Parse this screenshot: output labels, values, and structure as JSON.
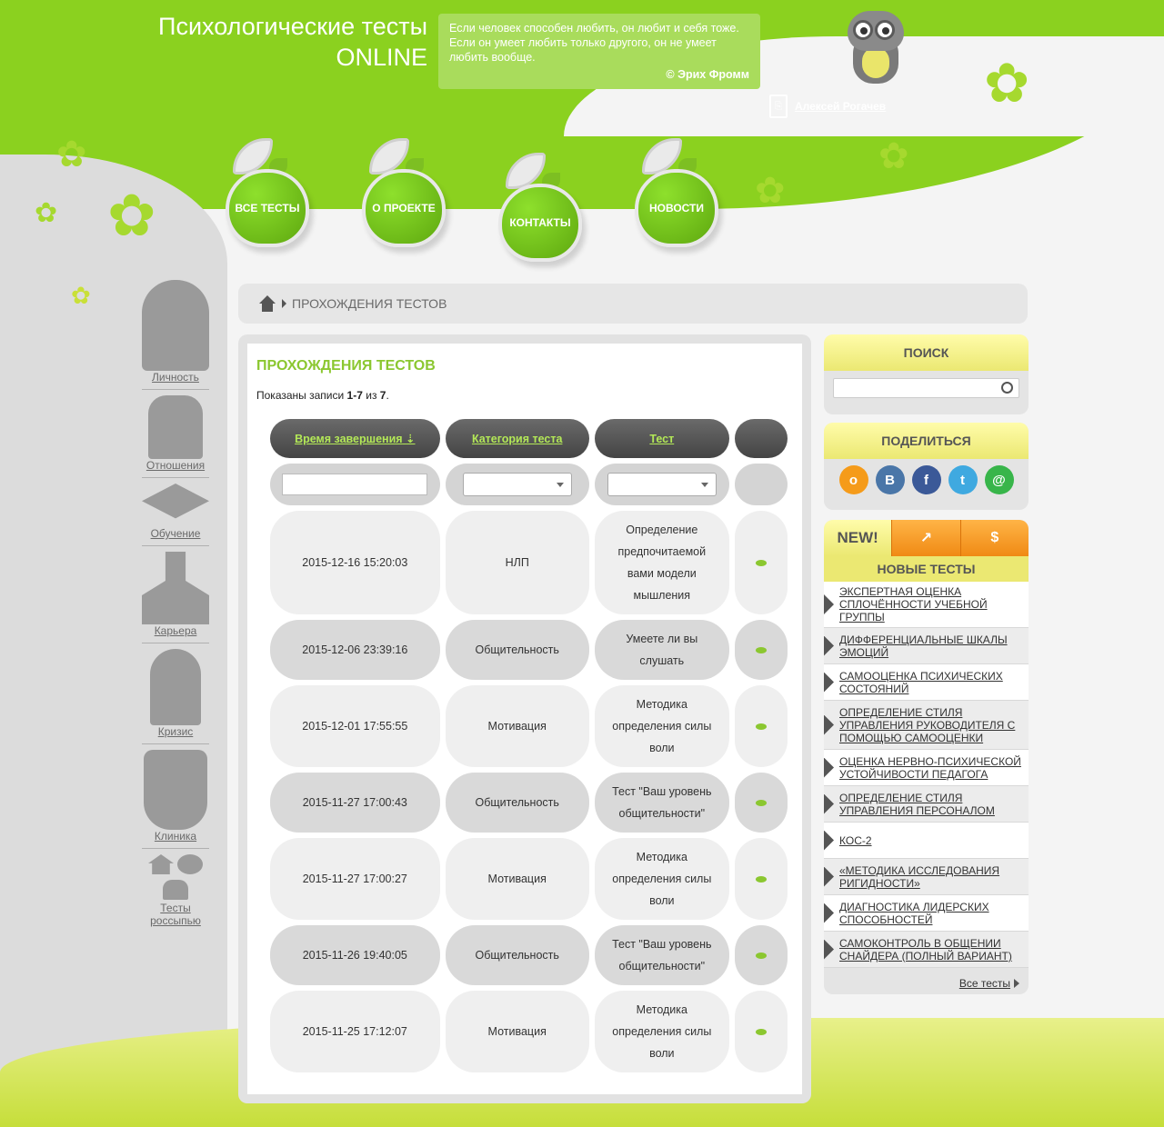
{
  "site": {
    "title_line1": "Психологические тесты",
    "title_line2": "ONLINE",
    "quote": "Если человек способен любить, он любит и себя тоже. Если он умеет любить только другого, он не умеет любить вообще.",
    "quote_author": "© Эрих Фромм",
    "user_name": "Алексей Рогачев"
  },
  "nav": [
    {
      "label": "ВСЕ ТЕСТЫ"
    },
    {
      "label": "О ПРОЕКТЕ"
    },
    {
      "label": "КОНТАКТЫ"
    },
    {
      "label": "НОВОСТИ"
    }
  ],
  "sidebar": {
    "items": [
      {
        "label": "Личность"
      },
      {
        "label": "Отношения"
      },
      {
        "label": "Обучение"
      },
      {
        "label": "Карьера"
      },
      {
        "label": "Кризис"
      },
      {
        "label": "Клиника"
      },
      {
        "label": "Тесты россыпью"
      }
    ]
  },
  "breadcrumb": {
    "current": "ПРОХОЖДЕНИЯ ТЕСТОВ"
  },
  "main": {
    "heading": "ПРОХОЖДЕНИЯ ТЕСТОВ",
    "count_prefix": "Показаны записи",
    "count_range": "1-7",
    "count_of": "из",
    "count_total": "7",
    "columns": [
      "Время завершения",
      "Категория теста",
      "Тест"
    ],
    "rows": [
      {
        "time": "2015-12-16 15:20:03",
        "category": "НЛП",
        "test": "Определение предпочитаемой вами модели мышления"
      },
      {
        "time": "2015-12-06 23:39:16",
        "category": "Общительность",
        "test": "Умеете ли вы слушать"
      },
      {
        "time": "2015-12-01 17:55:55",
        "category": "Мотивация",
        "test": "Методика определения силы воли"
      },
      {
        "time": "2015-11-27 17:00:43",
        "category": "Общительность",
        "test": "Тест \"Ваш уровень общительности\""
      },
      {
        "time": "2015-11-27 17:00:27",
        "category": "Мотивация",
        "test": "Методика определения силы воли"
      },
      {
        "time": "2015-11-26 19:40:05",
        "category": "Общительность",
        "test": "Тест \"Ваш уровень общительности\""
      },
      {
        "time": "2015-11-25 17:12:07",
        "category": "Мотивация",
        "test": "Методика определения силы воли"
      }
    ]
  },
  "right": {
    "search_title": "ПОИСК",
    "share_title": "ПОДЕЛИТЬСЯ",
    "tab_new": "NEW!",
    "new_tests_title": "НОВЫЕ ТЕСТЫ",
    "new_tests": [
      "ЭКСПЕРТНАЯ ОЦЕНКА СПЛОЧЁННОСТИ УЧЕБНОЙ ГРУППЫ",
      "ДИФФЕРЕНЦИАЛЬНЫЕ ШКАЛЫ ЭМОЦИЙ",
      "САМООЦЕНКА ПСИХИЧЕСКИХ СОСТОЯНИЙ",
      "ОПРЕДЕЛЕНИЕ СТИЛЯ УПРАВЛЕНИЯ РУКОВОДИТЕЛЯ С ПОМОЩЬЮ САМООЦЕНКИ",
      "ОЦЕНКА НЕРВНО-ПСИХИЧЕСКОЙ УСТОЙЧИВОСТИ ПЕДАГОГА",
      "ОПРЕДЕЛЕНИЕ СТИЛЯ УПРАВЛЕНИЯ ПЕРСОНАЛОМ",
      "КОС-2",
      "«МЕТОДИКА ИССЛЕДОВАНИЯ РИГИДНОСТИ»",
      "ДИАГНОСТИКА ЛИДЕРСКИХ СПОСОБНОСТЕЙ",
      "САМОКОНТРОЛЬ В ОБЩЕНИИ СНАЙДЕРА (ПОЛНЫЙ ВАРИАНТ)"
    ],
    "all_tests": "Все тесты"
  },
  "colors": {
    "accent": "#8bd11f",
    "orange": "#f08a14",
    "yellow": "#ebe872"
  }
}
